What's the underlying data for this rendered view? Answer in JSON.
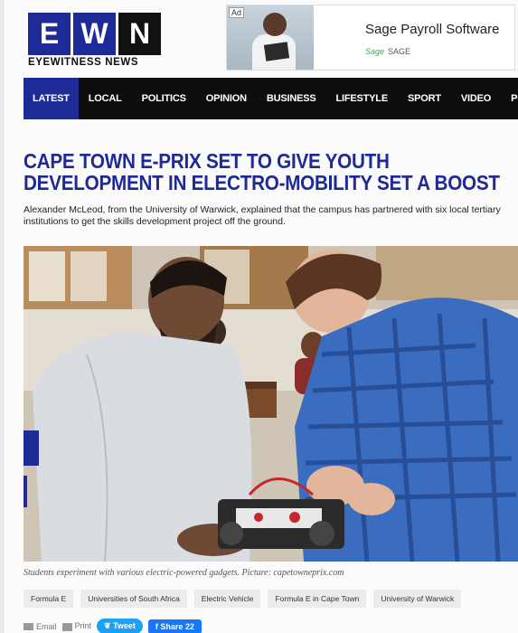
{
  "header": {
    "logo_letters": [
      "E",
      "W",
      "N"
    ],
    "logo_subtitle": "EYEWITNESS NEWS"
  },
  "ad": {
    "tag": "Ad",
    "title": "Sage Payroll Software",
    "brand_logo": "Sage",
    "brand": "SAGE"
  },
  "nav": {
    "items": [
      "LATEST",
      "LOCAL",
      "POLITICS",
      "OPINION",
      "BUSINESS",
      "LIFESTYLE",
      "SPORT",
      "VIDEO",
      "PODCASTS"
    ]
  },
  "article": {
    "headline_line1": "CAPE TOWN E-PRIX SET TO GIVE YOUTH",
    "headline_line2": "DEVELOPMENT IN ELECTRO-MOBILITY SET A BOOST",
    "lede": "Alexander McLeod, from the University of Warwick, explained that the campus has partnered with six local tertiary institutions to get the skills development project off the ground.",
    "caption": "Students experiment with various electric-powered gadgets. Picture: capetowneprix.com",
    "tags": [
      "Formula E",
      "Universities of South Africa",
      "Electric Vehicle",
      "Formula E in Cape Town",
      "University of Warwick"
    ]
  },
  "share": {
    "email": "Email",
    "print": "Print",
    "tweet": "Tweet",
    "share": "Share",
    "share_count": "22"
  },
  "colors": {
    "brand_blue": "#1e2a96",
    "nav_bg": "#0e0e0e",
    "tweet": "#1da1f2",
    "facebook": "#1877f2"
  }
}
